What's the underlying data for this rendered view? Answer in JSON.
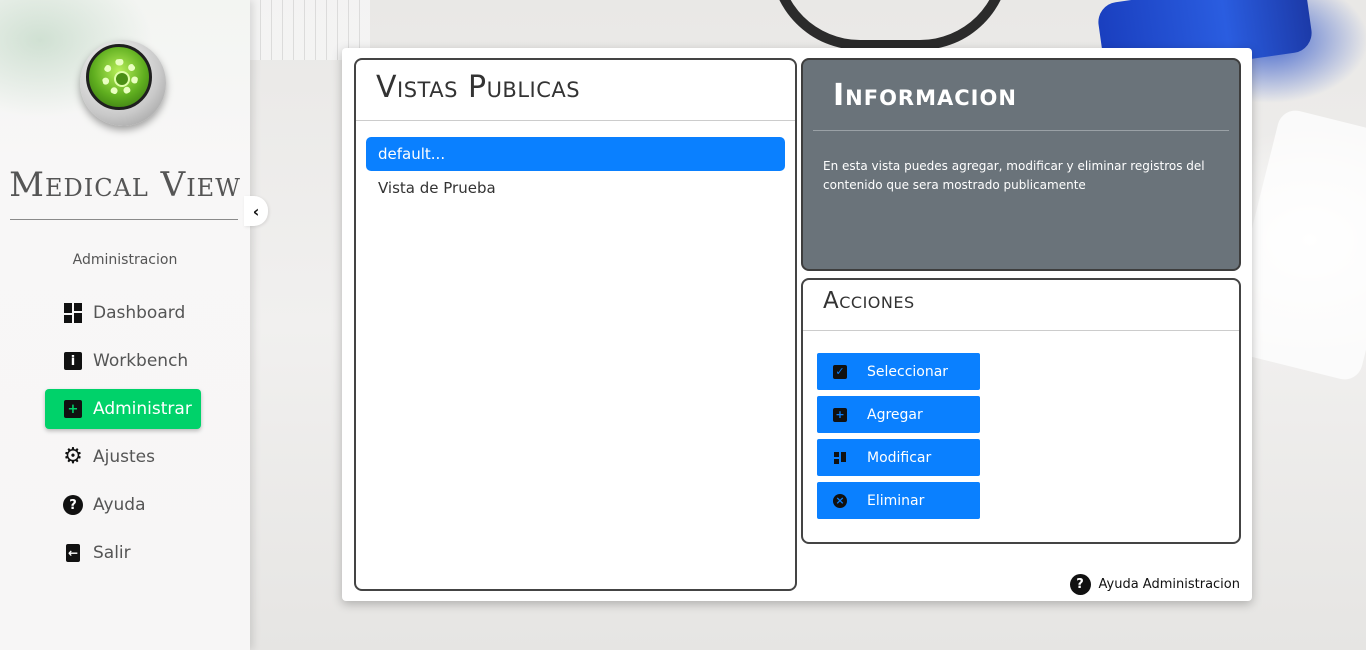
{
  "app": {
    "brand": "Medical View"
  },
  "sidebar": {
    "section_label": "Administracion",
    "items": [
      {
        "label": "Dashboard",
        "icon": "dashboard-icon"
      },
      {
        "label": "Workbench",
        "icon": "info-icon"
      },
      {
        "label": "Administrar",
        "icon": "plus-square-icon",
        "active": true
      },
      {
        "label": "Ajustes",
        "icon": "gear-icon"
      },
      {
        "label": "Ayuda",
        "icon": "question-icon"
      },
      {
        "label": "Salir",
        "icon": "exit-icon"
      }
    ],
    "collapse_glyph": "‹"
  },
  "vistas": {
    "title": "Vistas Publicas",
    "items": [
      {
        "label": "default...",
        "selected": true
      },
      {
        "label": "Vista de Prueba",
        "selected": false
      }
    ]
  },
  "info": {
    "title": "Informacion",
    "text": "En esta vista puedes agregar, modificar y eliminar registros del contenido que sera mostrado publicamente"
  },
  "acciones": {
    "title": "Acciones",
    "buttons": [
      {
        "label": "Seleccionar",
        "icon": "select-icon"
      },
      {
        "label": "Agregar",
        "icon": "add-icon"
      },
      {
        "label": "Modificar",
        "icon": "edit-icon"
      },
      {
        "label": "Eliminar",
        "icon": "delete-icon"
      }
    ]
  },
  "help": {
    "label": "Ayuda Administracion"
  },
  "colors": {
    "accent_blue": "#0a80ff",
    "active_green": "#00d26a",
    "info_gray": "#6a737a"
  }
}
